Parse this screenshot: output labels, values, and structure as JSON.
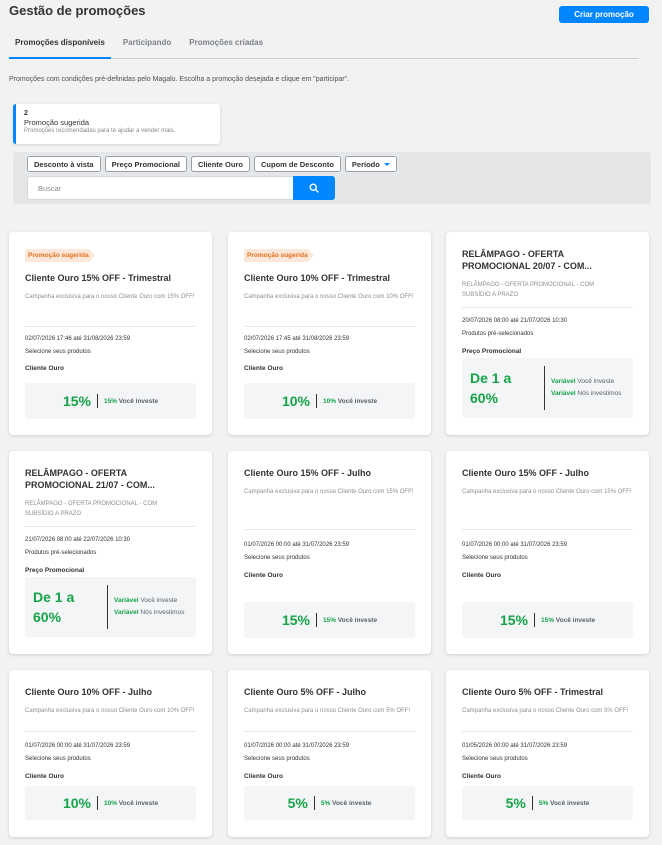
{
  "header": {
    "title": "Gestão de promoções",
    "create_button": "Criar promoção",
    "tabs": [
      {
        "label": "Promoções disponíveis",
        "active": true
      },
      {
        "label": "Participando",
        "active": false
      },
      {
        "label": "Promoções criadas",
        "active": false
      }
    ],
    "description": "Promoções com condições pré-definidas pelo Magalu. Escolha a promoção desejada e clique em \"participar\"."
  },
  "suggestion": {
    "count": "2",
    "title": "Promoção sugerida",
    "subtitle": "Promoções recomendadas para te ajudar a vender mais."
  },
  "filters": {
    "chips": [
      "Desconto à vista",
      "Preço Promocional",
      "Cliente Ouro",
      "Cupom de Desconto",
      "Período"
    ],
    "search_placeholder": "Buscar",
    "search_icon": "search-icon"
  },
  "cards": [
    {
      "badge": "Promoção sugerida",
      "title": "Cliente Ouro 15% OFF - Trimestral",
      "desc": "Campanha exclusiva para o nosso Cliente Ouro com 15% OFF!",
      "dates": "02/07/2026 17:46 até 31/08/2026 23:59",
      "mode": "Selecione seus produtos",
      "label": "Cliente Ouro",
      "percent": "15%",
      "invest_pct": "15%",
      "invest_text": "Você investe"
    },
    {
      "badge": "Promoção sugerida",
      "title": "Cliente Ouro 10% OFF - Trimestral",
      "desc": "Campanha exclusiva para o nosso Cliente Ouro com 10% OFF!",
      "dates": "02/07/2026 17:45 até 31/08/2026 23:59",
      "mode": "Selecione seus produtos",
      "label": "Cliente Ouro",
      "percent": "10%",
      "invest_pct": "10%",
      "invest_text": "Você investe"
    },
    {
      "title": "RELÂMPAGO - OFERTA PROMOCIONAL 20/07 - COM...",
      "desc": "RELÂMPAGO - OFERTA PROMOCIONAL - COM SUBSÍDIO A PRAZO",
      "dates": "20/07/2026 08:00 até 21/07/2026 10:30",
      "mode": "Produtos pré-selecionados",
      "label": "Preço Promocional",
      "range": "De 1 a 60%",
      "var1": "Variável",
      "var1_text": "Você investe",
      "var2": "Variável",
      "var2_text": "Nós investimos"
    },
    {
      "title": "RELÂMPAGO - OFERTA PROMOCIONAL 21/07 - COM...",
      "desc": "RELÂMPAGO - OFERTA PROMOCIONAL - COM SUBSÍDIO A PRAZO",
      "dates": "21/07/2026 08:00 até 22/07/2026 10:30",
      "mode": "Produtos pré-selecionados",
      "label": "Preço Promocional",
      "range": "De 1 a 60%",
      "var1": "Variável",
      "var1_text": "Você investe",
      "var2": "Variável",
      "var2_text": "Nós investimos"
    },
    {
      "title": "Cliente Ouro 15% OFF - Julho",
      "desc": "Campanha exclusiva para o nosso Cliente Ouro com 15% OFF!",
      "dates": "01/07/2026 00:00 até 31/07/2026 23:59",
      "mode": "Selecione seus produtos",
      "label": "Cliente Ouro",
      "percent": "15%",
      "invest_pct": "15%",
      "invest_text": "Você investe"
    },
    {
      "title": "Cliente Ouro 15% OFF - Julho",
      "desc": "Campanha exclusiva para o nosso Cliente Ouro com 15% OFF!",
      "dates": "01/07/2026 00:00 até 31/07/2026 23:59",
      "mode": "Selecione seus produtos",
      "label": "Cliente Ouro",
      "percent": "15%",
      "invest_pct": "15%",
      "invest_text": "Você investe"
    },
    {
      "title": "Cliente Ouro 10% OFF - Julho",
      "desc": "Campanha exclusiva para o nosso Cliente Ouro com 10% OFF!",
      "dates": "01/07/2026 00:00 até 31/07/2026 23:59",
      "mode": "Selecione seus produtos",
      "label": "Cliente Ouro",
      "percent": "10%",
      "invest_pct": "10%",
      "invest_text": "Você investe"
    },
    {
      "title": "Cliente Ouro 5% OFF - Julho",
      "desc": "Campanha exclusiva para o nosso Cliente Ouro com 5% OFF!",
      "dates": "01/07/2026 00:00 até 31/07/2026 23:59",
      "mode": "Selecione seus produtos",
      "label": "Cliente Ouro",
      "percent": "5%",
      "invest_pct": "5%",
      "invest_text": "Você investe"
    },
    {
      "title": "Cliente Ouro 5% OFF - Trimestral",
      "desc": "Campanha exclusiva para o nosso Cliente Ouro com 5% OFF!",
      "dates": "01/05/2026 00:00 até 31/07/2026 23:59",
      "mode": "Selecione seus produtos",
      "label": "Cliente Ouro",
      "percent": "5%",
      "invest_pct": "5%",
      "invest_text": "Você investe"
    }
  ],
  "colors": {
    "primary": "#0086ff",
    "success": "#15a348",
    "badge_bg": "#fde7d8",
    "badge_text": "#e0701c"
  }
}
